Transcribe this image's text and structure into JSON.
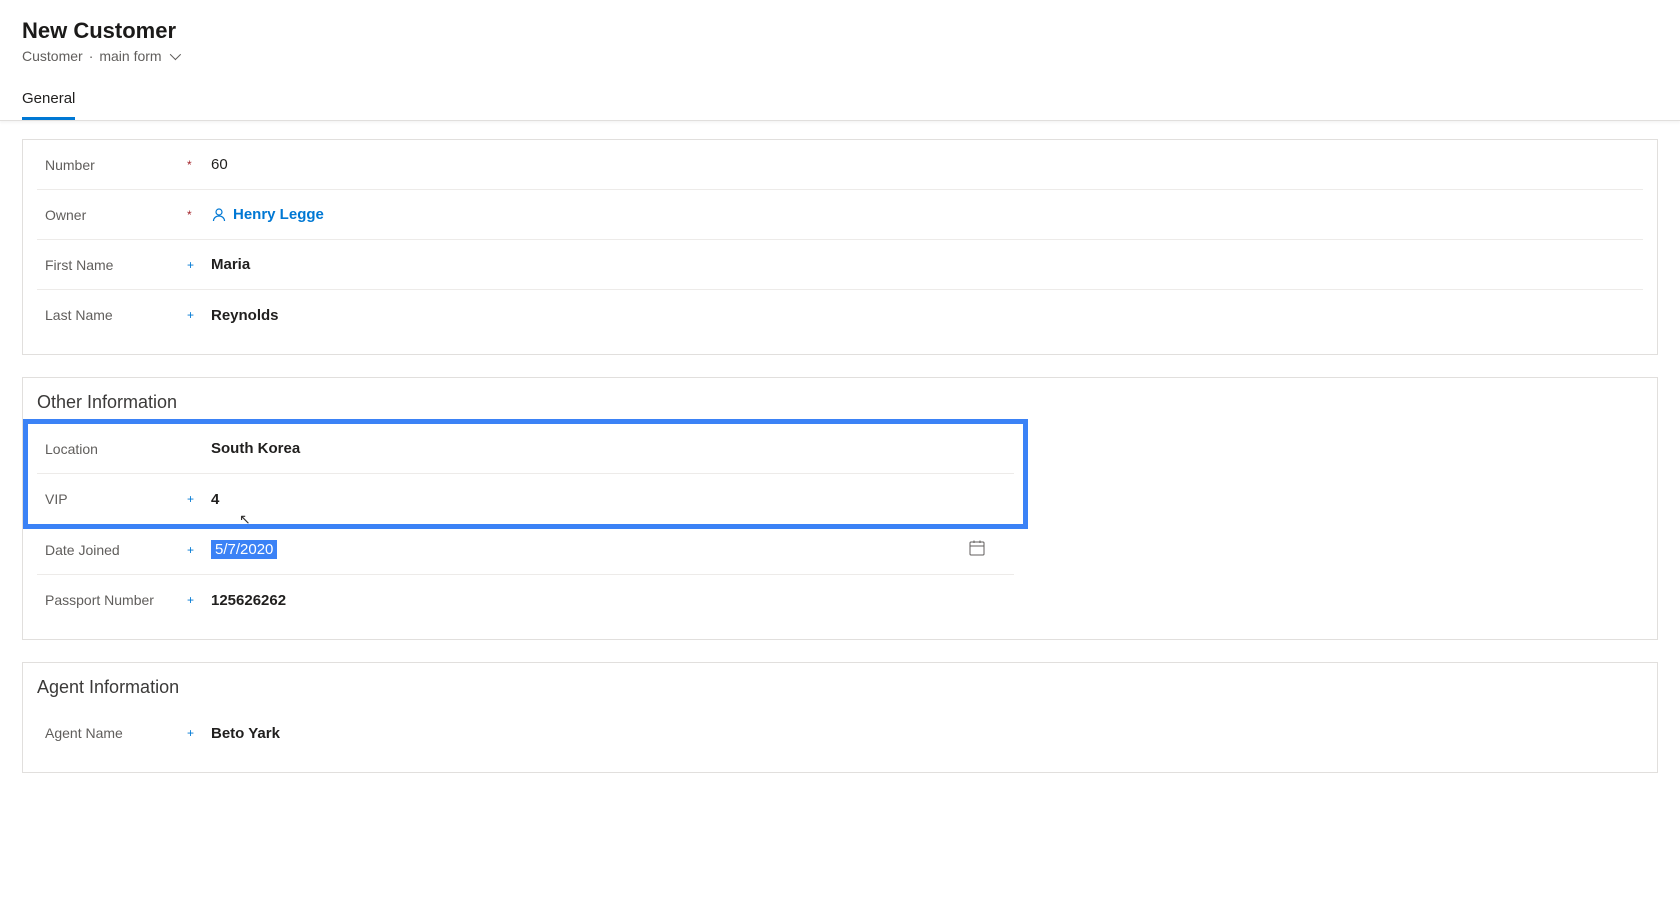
{
  "header": {
    "title": "New Customer",
    "entity": "Customer",
    "form_name": "main form"
  },
  "tabs": {
    "general": "General"
  },
  "section1": {
    "fields": {
      "number": {
        "label": "Number",
        "value": "60"
      },
      "owner": {
        "label": "Owner",
        "value": "Henry Legge"
      },
      "first_name": {
        "label": "First Name",
        "value": "Maria"
      },
      "last_name": {
        "label": "Last Name",
        "value": "Reynolds"
      }
    }
  },
  "section2": {
    "title": "Other Information",
    "fields": {
      "location": {
        "label": "Location",
        "value": "South Korea"
      },
      "vip": {
        "label": "VIP",
        "value": "4"
      },
      "date_joined": {
        "label": "Date Joined",
        "value": "5/7/2020"
      },
      "passport": {
        "label": "Passport Number",
        "value": "125626262"
      }
    }
  },
  "section3": {
    "title": "Agent Information",
    "fields": {
      "agent_name": {
        "label": "Agent Name",
        "value": "Beto Yark"
      }
    }
  }
}
